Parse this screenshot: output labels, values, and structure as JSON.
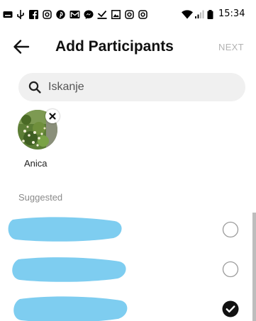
{
  "status_bar": {
    "time": "15:34",
    "icons": [
      "keyboard-icon",
      "usb-icon",
      "facebook-icon",
      "instagram-icon",
      "pinterest-icon",
      "gmail-icon",
      "messenger-icon",
      "download-icon",
      "gallery-icon",
      "instagram-icon",
      "instagram-icon",
      "wifi-icon",
      "signal-icon",
      "battery-icon"
    ]
  },
  "header": {
    "title": "Add Participants",
    "next_label": "NEXT"
  },
  "search": {
    "placeholder": "Iskanje",
    "value": ""
  },
  "selected": [
    {
      "name": "Anica",
      "avatar": "nature-photo-avatar"
    }
  ],
  "suggested": {
    "label": "Suggested",
    "items": [
      {
        "name_redacted": true,
        "selected": false
      },
      {
        "name_redacted": true,
        "selected": false
      },
      {
        "name_redacted": true,
        "selected": true
      }
    ]
  },
  "colors": {
    "redaction": "#7ecdf0",
    "next_disabled": "#b3b3b3",
    "search_bg": "#f0f0f0"
  }
}
